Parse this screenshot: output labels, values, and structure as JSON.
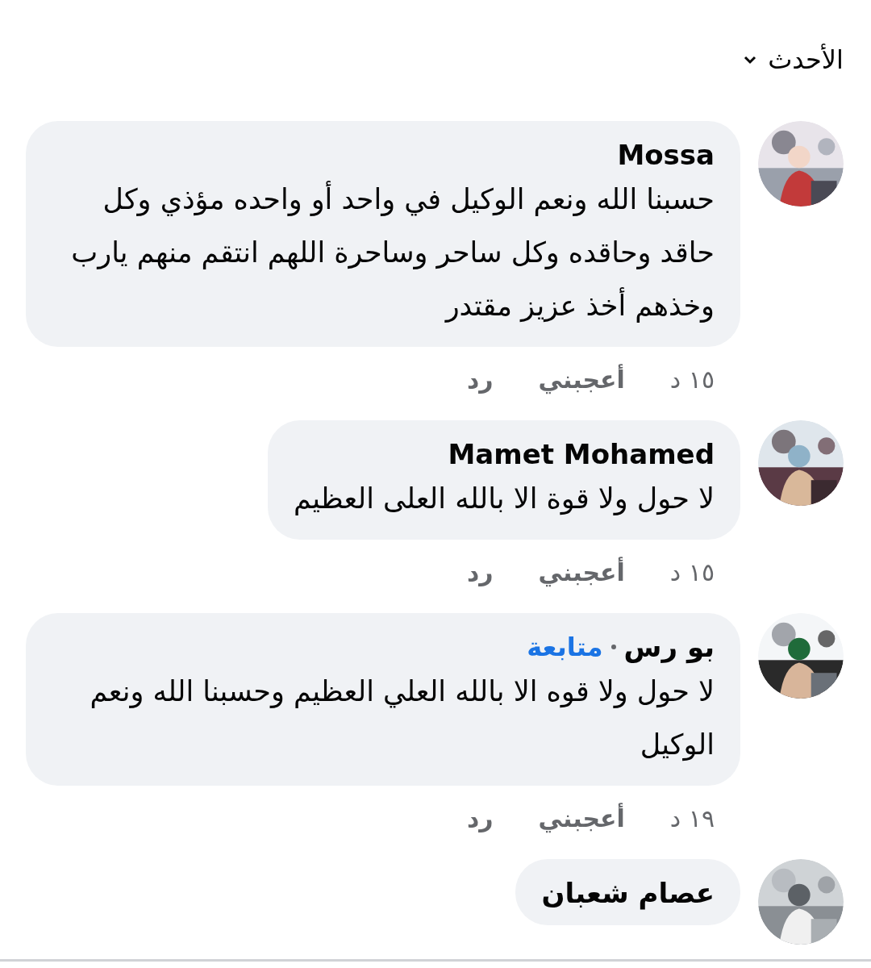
{
  "sort": {
    "label": "الأحدث"
  },
  "comments": [
    {
      "name": "Mossa",
      "text": "حسبنا الله ونعم الوكيل في واحد أو واحده مؤذي وكل حاقد وحاقده وكل ساحر وساحرة اللهم انتقم منهم يارب وخذهم أخذ عزيز مقتدر",
      "time": "١٥ د",
      "like": "أعجبني",
      "reply": "رد"
    },
    {
      "name": "Mamet Mohamed",
      "text": "لا حول ولا قوة الا بالله العلى العظيم",
      "time": "١٥ د",
      "like": "أعجبني",
      "reply": "رد"
    },
    {
      "name": "بو رس",
      "follow": "متابعة",
      "text": "لا حول ولا قوه الا بالله العلي العظيم وحسبنا الله ونعم الوكيل",
      "time": "١٩ د",
      "like": "أعجبني",
      "reply": "رد"
    },
    {
      "name": "عصام شعبان"
    }
  ]
}
